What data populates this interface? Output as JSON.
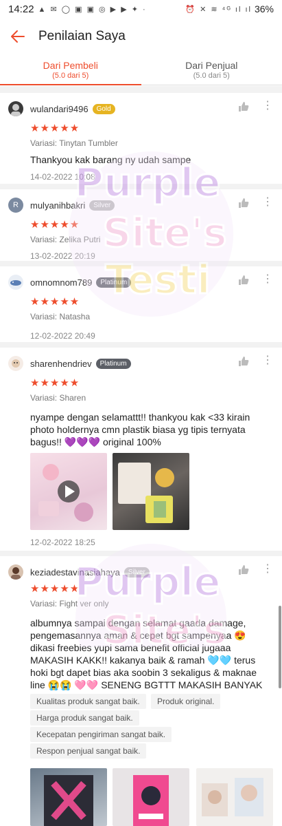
{
  "status_bar": {
    "time": "14:22",
    "left_icons": "▲ ✉ ◯ ▣ ▣ ◎ ▶ ▶ ✦ ·",
    "right_icons": "⏰ ✕ ≋ ⁴ᴳ ıl ıl",
    "battery": "36%"
  },
  "app_bar": {
    "title": "Penilaian Saya"
  },
  "tabs": [
    {
      "label": "Dari Pembeli",
      "sub": "(5.0 dari 5)"
    },
    {
      "label": "Dari Penjual",
      "sub": "(5.0 dari 5)"
    }
  ],
  "reviews": [
    {
      "username": "wulandari9496",
      "badge": "Gold",
      "stars": "★★★★★",
      "variasi": "Variasi: Tinytan Tumbler",
      "text": "Thankyou kak barang ny udah sampe",
      "date": "14-02-2022 10:08"
    },
    {
      "avatar_letter": "R",
      "username": "mulyanihbakri",
      "badge": "Silver",
      "stars": "★★★★★",
      "variasi": "Variasi: Zelika Putri",
      "date": "13-02-2022 20:19"
    },
    {
      "username": "omnomnom789",
      "badge": "Platinum",
      "stars": "★★★★★",
      "variasi": "Variasi: Natasha",
      "date": "12-02-2022 20:49"
    },
    {
      "username": "sharenhendriev",
      "badge": "Platinum",
      "stars": "★★★★★",
      "variasi": "Variasi: Sharen",
      "text": "nyampe dengan selamattt!! thankyou kak <33 kirain photo holdernya cmn plastik biasa yg tipis ternyata bagus!! 💜💜💜 original 100%",
      "date": "12-02-2022 18:25"
    },
    {
      "username": "keziadestavinasiahaya",
      "badge": "Silver",
      "stars": "★★★★★",
      "variasi": "Variasi: Fight ver only",
      "text": "albumnya sampai dengan selamat gaada damage, pengemasannya aman & cepet bgt sampenyaa 😍 dikasi freebies yupi sama benefit official jugaaa MAKASIH KAKK!! kakanya baik & ramah 🩵🩵 terus hoki bgt dapet bias aka soobin 3 sekaligus & maknae line 😭😭 🩷🩷 SENENG BGTTT MAKASIH BANYAK KAK!! sukses selaluu",
      "tags": [
        "Kualitas produk sangat baik.",
        "Produk original.",
        "Harga produk sangat baik.",
        "Kecepatan pengiriman sangat baik.",
        "Respon penjual sangat baik."
      ]
    }
  ],
  "watermark": {
    "line1": "Purple",
    "line2": "Site's",
    "line3": "Testi",
    "color": "#c79ae6"
  },
  "colors": {
    "accent": "#ee4d2d",
    "gold": "#e6b422"
  }
}
